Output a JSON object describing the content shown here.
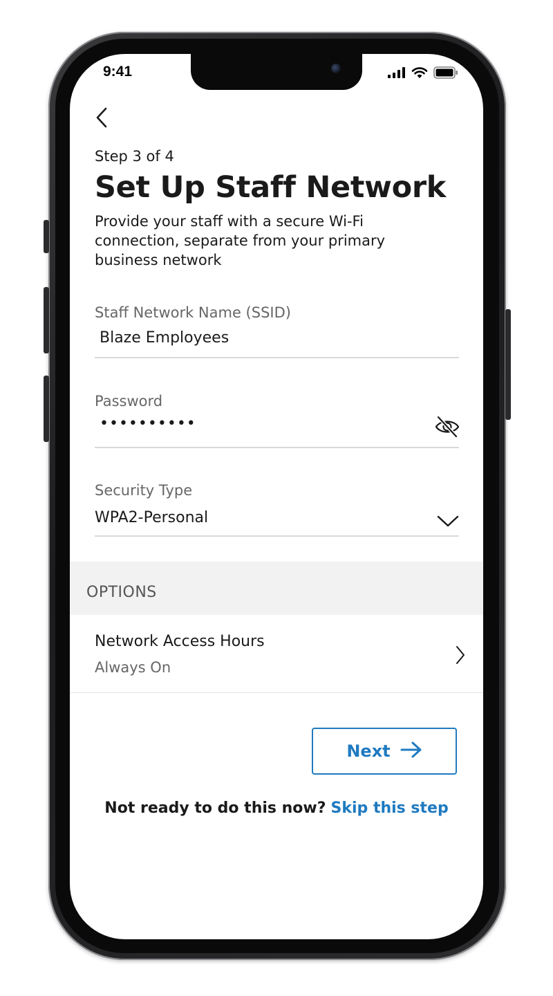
{
  "status_bar": {
    "time": "9:41",
    "icons": [
      "cellular-signal-icon",
      "wifi-icon",
      "battery-icon"
    ]
  },
  "header": {
    "back_icon": "chevron-left-icon",
    "step": "Step 3 of 4",
    "title": "Set Up Staff Network",
    "description": "Provide your staff with a secure Wi-Fi connection, separate from your primary business network"
  },
  "form": {
    "ssid": {
      "label": "Staff Network Name (SSID)",
      "value": "Blaze Employees"
    },
    "password": {
      "label": "Password",
      "value": "••••••••••",
      "toggle_icon": "eye-off-icon"
    },
    "security": {
      "label": "Security Type",
      "value": "WPA2-Personal",
      "dropdown_icon": "chevron-down-icon"
    }
  },
  "options": {
    "header": "OPTIONS",
    "items": [
      {
        "title": "Network Access Hours",
        "subtitle": "Always On",
        "icon": "chevron-right-icon"
      }
    ]
  },
  "actions": {
    "next_label": "Next",
    "next_icon": "arrow-right-icon",
    "skip_prompt": "Not ready to do this now?",
    "skip_link": "Skip this step"
  },
  "colors": {
    "accent": "#1f7ac0",
    "text": "#1a1a1a",
    "muted": "#666666",
    "divider": "#d9d9d9",
    "section_bg": "#f2f2f2"
  }
}
